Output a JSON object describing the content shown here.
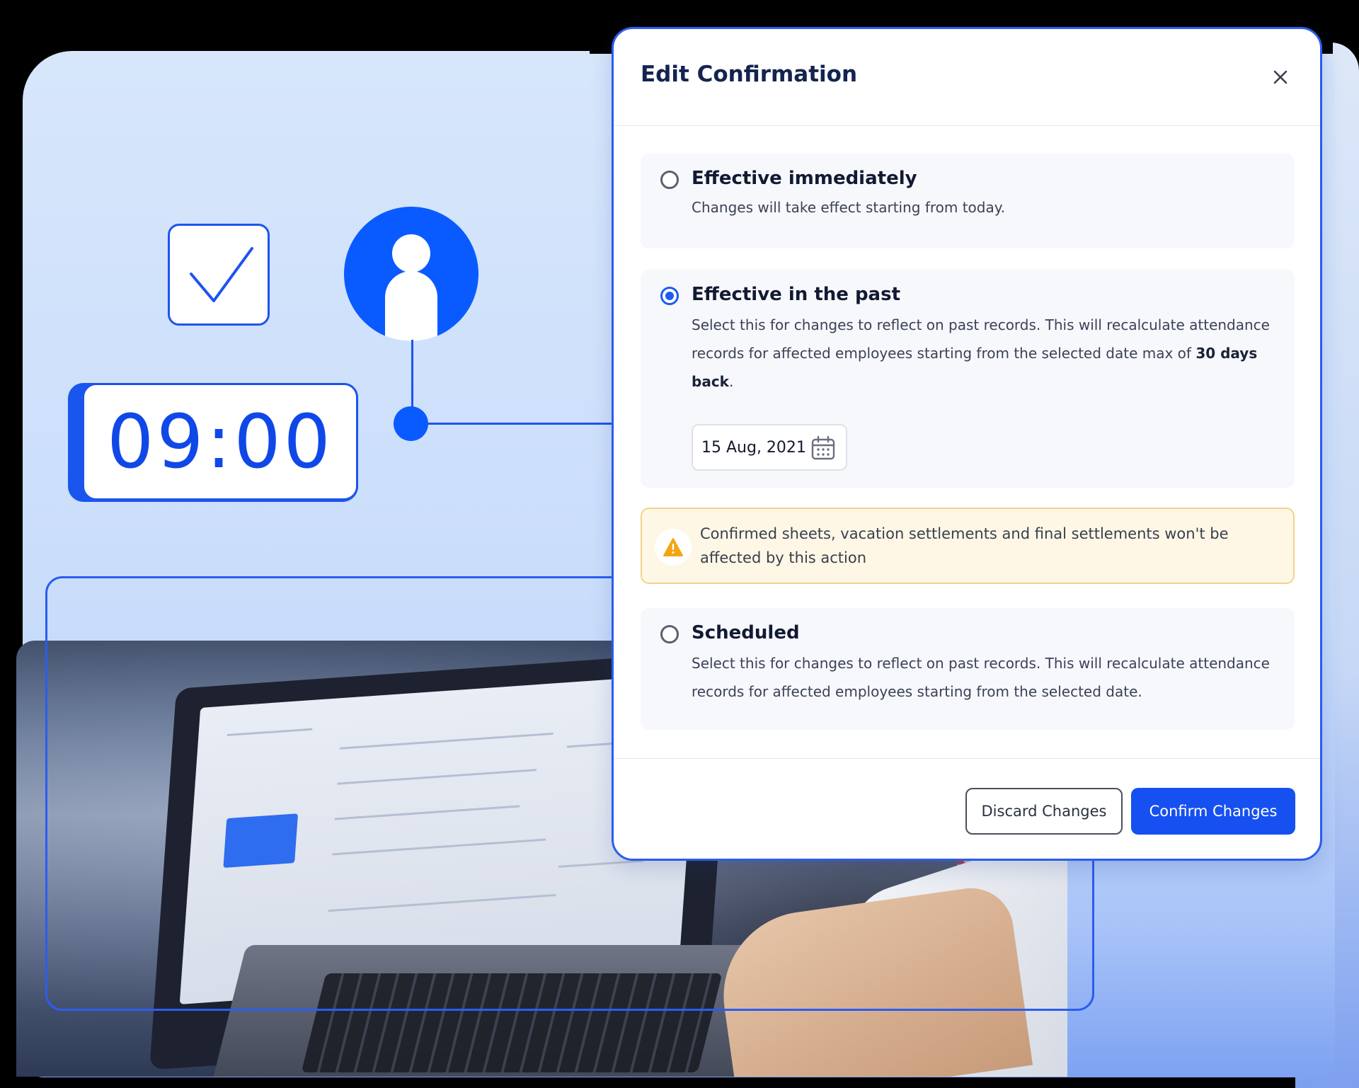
{
  "illustration": {
    "clock_time": "09:00",
    "accent_color": "#1650f0"
  },
  "modal": {
    "title": "Edit Confirmation",
    "close_icon": "close-icon",
    "options": [
      {
        "title": "Effective immediately",
        "description": "Changes will take effect starting from today.",
        "selected": false
      },
      {
        "title": "Effective in the past",
        "description_prefix": "Select this for changes to reflect on past records. This will recalculate attendance records for affected employees starting from the selected date max of ",
        "description_bold": "30 days back",
        "description_suffix": ".",
        "selected": true,
        "date_value": "15 Aug, 2021",
        "date_icon": "calendar-icon"
      },
      {
        "title": "Scheduled",
        "description": "Select this for changes to reflect on past records. This will recalculate attendance records for affected employees starting from the selected date.",
        "selected": false
      }
    ],
    "warning": {
      "icon": "warning-icon",
      "text": "Confirmed sheets, vacation settlements and final settlements won't be affected by this action"
    },
    "footer": {
      "discard_label": "Discard Changes",
      "confirm_label": "Confirm Changes"
    }
  }
}
